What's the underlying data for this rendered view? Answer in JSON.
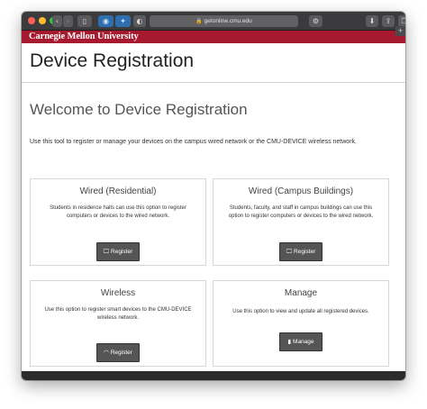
{
  "browser": {
    "address": "getonline.cmu.edu",
    "icons": {
      "back": "chevron-left-icon",
      "forward": "chevron-right-icon",
      "sidebar": "sidebar-icon",
      "lock": "lock-icon",
      "settings": "gear-icon",
      "download": "download-icon",
      "share": "share-icon",
      "tabs": "tabs-icon",
      "new_tab": "plus-icon"
    }
  },
  "brand": {
    "logo_text": "Carnegie Mellon University",
    "color": "#a6192e"
  },
  "page": {
    "title": "Device Registration",
    "welcome": "Welcome to Device Registration",
    "intro": "Use this tool to register or manage your devices on the campus wired network or the CMU-DEVICE wireless network."
  },
  "cards": [
    {
      "title": "Wired (Residential)",
      "description": "Students in residence halls can use this option to register computers or devices to the wired network.",
      "button": "Register",
      "icon": "monitor-icon"
    },
    {
      "title": "Wired (Campus Buildings)",
      "description": "Students, faculty, and staff in campus buildings can use this option to register computers or devices to the wired network.",
      "button": "Register",
      "icon": "monitor-icon"
    },
    {
      "title": "Wireless",
      "description": "Use this option to register smart devices to the CMU-DEVICE wireless network.",
      "button": "Register",
      "icon": "wifi-icon"
    },
    {
      "title": "Manage",
      "description": "Use this option to view and update all registered devices.",
      "button": "Manage",
      "icon": "document-icon"
    }
  ]
}
